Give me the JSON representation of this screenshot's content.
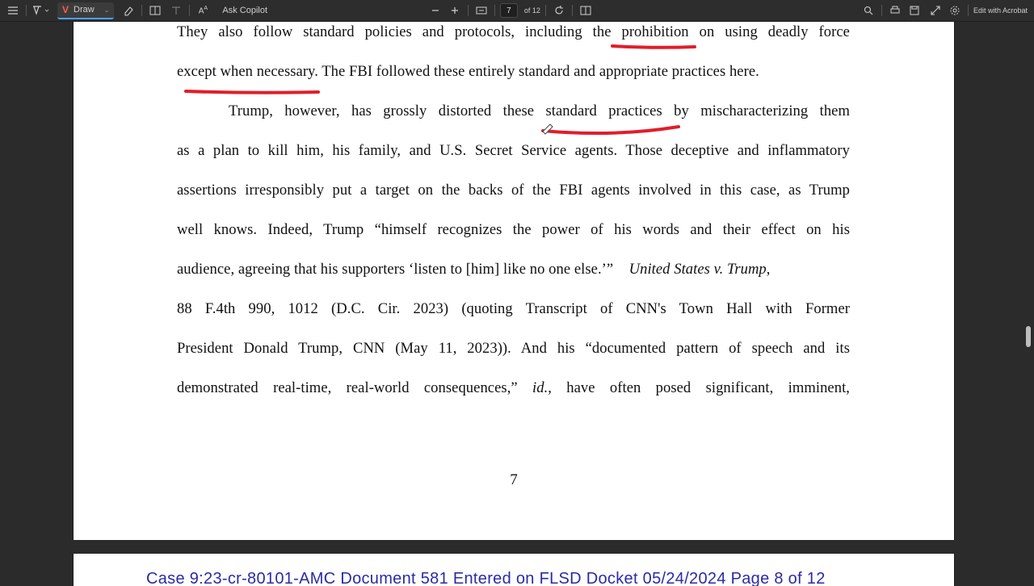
{
  "toolbar": {
    "draw_label": "Draw",
    "ask_copilot_label": "Ask Copilot",
    "page_current": "7",
    "page_total": "of 12",
    "edit_acrobat_label": "Edit with Acrobat",
    "icons": [
      "list-icon",
      "highlight-icon",
      "draw-icon",
      "eraser-icon",
      "split-view-icon",
      "text-icon",
      "read-aloud-icon",
      "zoom-out-icon",
      "zoom-in-icon",
      "fit-page-icon",
      "rotate-icon",
      "two-page-icon",
      "search-icon",
      "print-icon",
      "save-icon",
      "fullscreen-icon",
      "settings-icon"
    ]
  },
  "document": {
    "lines": [
      "They also follow standard policies and protocols, including the prohibition on using deadly force",
      "except when necessary.  The FBI followed these entirely standard and appropriate practices here.",
      "Trump, however, has grossly distorted these standard practices by mischaracterizing them",
      "as a plan to kill him, his family, and U.S. Secret Service agents.  Those deceptive and inflammatory",
      "assertions irresponsibly put a target on the backs of the FBI agents involved in this case, as Trump",
      "well knows.  Indeed, Trump “himself recognizes the power of his words and their effect on his",
      "audience, agreeing that his supporters ‘listen to [him] like no one else.’”",
      "United States v. Trump",
      ",",
      "88 F.4th 990, 1012 (D.C. Cir. 2023) (quoting Transcript of CNN's Town Hall with Former",
      "President Donald Trump, CNN (May 11, 2023)).  And his “documented pattern of speech and its",
      "demonstrated real-time, real-world consequences,”",
      "id.",
      ", have often posed significant, imminent,"
    ],
    "page_number": "7"
  },
  "next_page": {
    "header": "Case 9:23-cr-80101-AMC   Document 581   Entered on FLSD Docket 05/24/2024   Page 8 of 12"
  },
  "colors": {
    "ink": "#e01e2a",
    "header": "#2a2aa8",
    "toolbar_bg": "#2d2d2d"
  }
}
